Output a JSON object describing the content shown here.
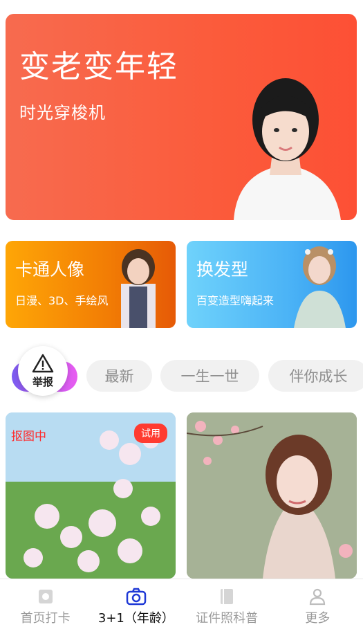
{
  "hero": {
    "title": "变老变年轻",
    "subtitle": "时光穿梭机"
  },
  "cards": [
    {
      "title": "卡通人像",
      "subtitle": "日漫、3D、手绘风"
    },
    {
      "title": "换发型",
      "subtitle": "百变造型嗨起来"
    }
  ],
  "tabs": {
    "report_label": "举报",
    "items": [
      "最新",
      "一生一世",
      "伴你成长"
    ]
  },
  "tiles": {
    "left_tag": "抠图中",
    "left_badge": "试用"
  },
  "bottom_nav": {
    "items": [
      {
        "label": "首页打卡",
        "icon": "frame-icon"
      },
      {
        "label": "3+1（年龄）",
        "icon": "camera-icon"
      },
      {
        "label": "证件照科普",
        "icon": "book-icon"
      },
      {
        "label": "更多",
        "icon": "user-icon"
      }
    ],
    "active_index": 1
  },
  "colors": {
    "hero": "#fb5b3b",
    "cartoon": "#f27d05",
    "hair": "#4bb3f6",
    "active_nav": "#1f39d6",
    "badge": "#ff3b30"
  }
}
